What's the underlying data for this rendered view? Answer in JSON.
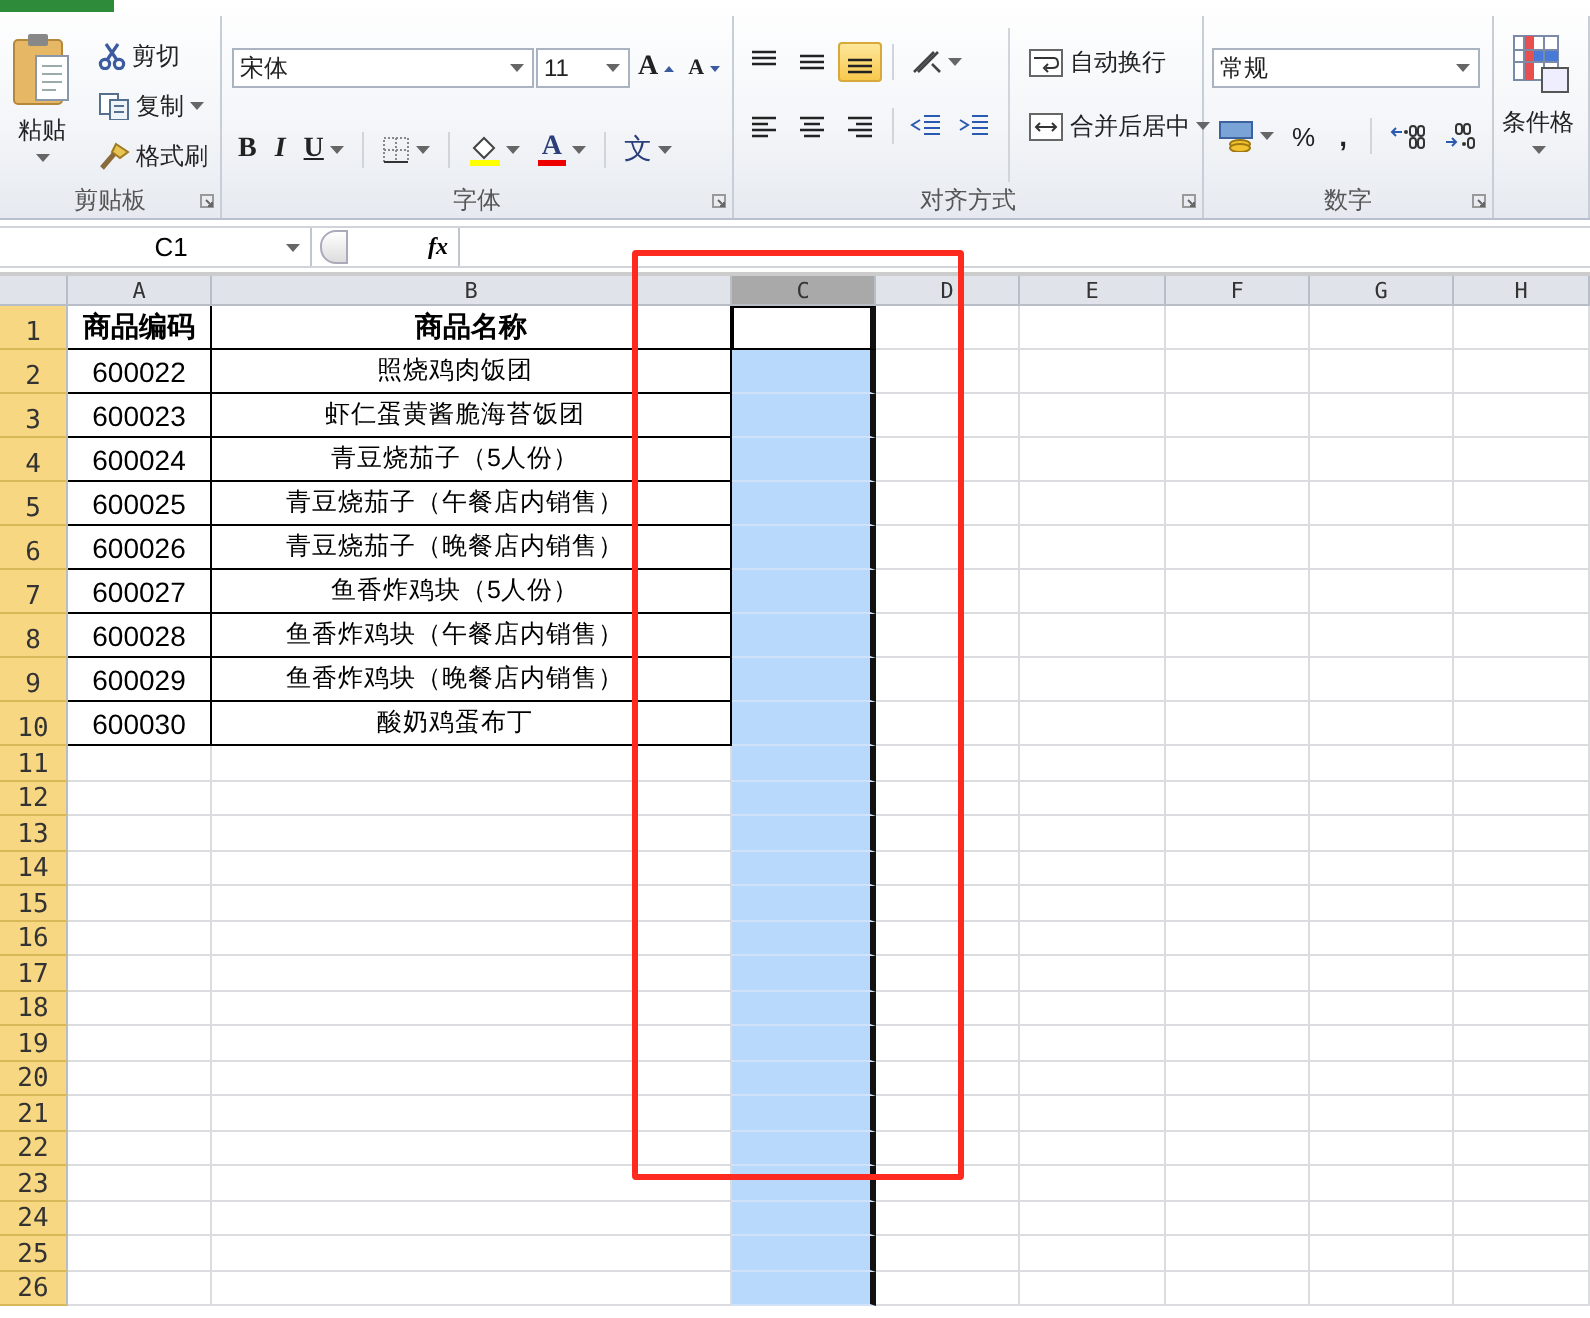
{
  "clipboard": {
    "label": "剪贴板",
    "paste": "粘贴",
    "cut": "剪切",
    "copy": "复制",
    "format_painter": "格式刷"
  },
  "font": {
    "label": "字体",
    "font_name": "宋体",
    "font_size": "11",
    "grow": "A",
    "shrink": "A",
    "bold": "B",
    "italic": "I",
    "underline": "U",
    "font_color": "A",
    "phonetic": "文"
  },
  "alignment": {
    "label": "对齐方式",
    "wrap_text": "自动换行",
    "merge_center": "合并后居中",
    "buttons": [
      {
        "kind": "top",
        "selected": false
      },
      {
        "kind": "middle",
        "selected": false
      },
      {
        "kind": "bottom",
        "selected": true
      },
      {
        "kind": "left",
        "selected": false
      },
      {
        "kind": "center",
        "selected": false
      },
      {
        "kind": "right",
        "selected": false
      }
    ]
  },
  "number": {
    "label": "数字",
    "format": "常规",
    "percent": "%",
    "comma": ","
  },
  "styles": {
    "conditional_formatting": "条件格"
  },
  "formula_bar": {
    "name_box": "C1",
    "fx": "fx"
  },
  "sheet": {
    "columns": [
      {
        "label": "A",
        "selected": false
      },
      {
        "label": "B",
        "selected": false
      },
      {
        "label": "C",
        "selected": true
      },
      {
        "label": "D",
        "selected": false
      },
      {
        "label": "E",
        "selected": false
      },
      {
        "label": "F",
        "selected": false
      },
      {
        "label": "G",
        "selected": false
      },
      {
        "label": "H",
        "selected": false
      }
    ],
    "row_numbers": [
      "1",
      "2",
      "3",
      "4",
      "5",
      "6",
      "7",
      "8",
      "9",
      "10",
      "11",
      "12",
      "13",
      "14",
      "15",
      "16",
      "17",
      "18",
      "19",
      "20",
      "21",
      "22",
      "23",
      "24",
      "25",
      "26"
    ],
    "rows": [
      [
        "商品编码",
        "商品名称"
      ],
      [
        "600022",
        "照烧鸡肉饭团"
      ],
      [
        "600023",
        "虾仁蛋黄酱脆海苔饭团"
      ],
      [
        "600024",
        "青豆烧茄子（5人份）"
      ],
      [
        "600025",
        "青豆烧茄子（午餐店内销售）"
      ],
      [
        "600026",
        "青豆烧茄子（晚餐店内销售）"
      ],
      [
        "600027",
        "鱼香炸鸡块（5人份）"
      ],
      [
        "600028",
        "鱼香炸鸡块（午餐店内销售）"
      ],
      [
        "600029",
        "鱼香炸鸡块（晚餐店内销售）"
      ],
      [
        "600030",
        "酸奶鸡蛋布丁"
      ]
    ]
  }
}
